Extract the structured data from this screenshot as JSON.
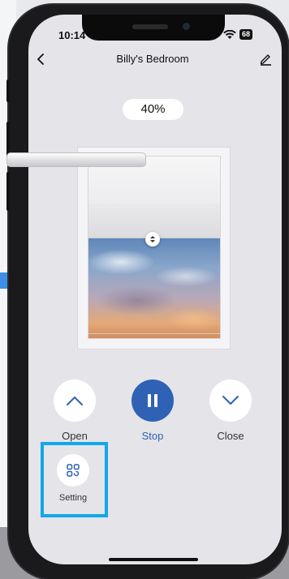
{
  "status": {
    "time": "10:14",
    "battery": "68"
  },
  "header": {
    "title": "Billy's Bedroom"
  },
  "curtain": {
    "percent_label": "40%",
    "open_percent": 40
  },
  "controls": {
    "open_label": "Open",
    "stop_label": "Stop",
    "close_label": "Close"
  },
  "setting": {
    "label": "Setting"
  },
  "colors": {
    "accent": "#2f62b5",
    "highlight": "#12a7ea",
    "screen_bg": "#e4e4e9"
  },
  "icons": {
    "back": "chevron-left-icon",
    "edit": "pencil-icon",
    "open": "chevron-up-icon",
    "stop": "pause-icon",
    "close": "chevron-down-icon",
    "setting": "grid-icon",
    "handle": "drag-handle-icon"
  }
}
